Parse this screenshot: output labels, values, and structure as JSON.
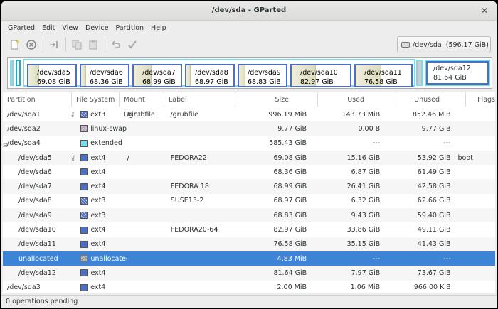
{
  "window": {
    "title": "/dev/sda - GParted"
  },
  "menu": [
    "GParted",
    "Edit",
    "View",
    "Device",
    "Partition",
    "Help"
  ],
  "toolbar": {
    "icons": [
      "new-icon",
      "delete-icon",
      "resize-move-icon",
      "copy-icon",
      "paste-icon",
      "undo-icon",
      "apply-icon"
    ]
  },
  "device": {
    "label": "/dev/sda",
    "size": "(596.17 GiB)"
  },
  "diskmap": {
    "parts": [
      {
        "name": "/dev/sda5",
        "size": "69.08 GiB",
        "used_fraction": 0.22
      },
      {
        "name": "/dev/sda6",
        "size": "68.36 GiB",
        "used_fraction": 0.1
      },
      {
        "name": "/dev/sda7",
        "size": "68.99 GiB",
        "used_fraction": 0.38
      },
      {
        "name": "/dev/sda8",
        "size": "68.97 GiB",
        "used_fraction": 0.09
      },
      {
        "name": "/dev/sda9",
        "size": "68.83 GiB",
        "used_fraction": 0.14
      },
      {
        "name": "/dev/sda10",
        "size": "82.97 GiB",
        "used_fraction": 0.41
      },
      {
        "name": "/dev/sda11",
        "size": "76.58 GiB",
        "used_fraction": 0.46
      }
    ],
    "last": {
      "name": "/dev/sda12",
      "size": "81.64 GiB"
    }
  },
  "columns": [
    "Partition",
    "File System",
    "Mount Point",
    "Label",
    "Size",
    "Used",
    "Unused",
    "Flags"
  ],
  "colors": {
    "ext3": "#4a6fc4",
    "ext4": "#4a6fc4",
    "linux-swap": "#c2a2b2",
    "extended": "#7ed8e8",
    "unallocated": "#a0a0a0",
    "selected": "#3d84d6"
  },
  "rows": [
    {
      "partition": "/dev/sda1",
      "key": true,
      "fs": "ext3",
      "mount": "/grubfile",
      "label": "/grubfile",
      "size": "996.19 MiB",
      "used": "143.73 MiB",
      "unused": "852.46 MiB",
      "flags": ""
    },
    {
      "partition": "/dev/sda2",
      "key": false,
      "fs": "linux-swap",
      "mount": "",
      "label": "",
      "size": "9.77 GiB",
      "used": "0.00 B",
      "unused": "9.77 GiB",
      "flags": ""
    },
    {
      "partition": "/dev/sda4",
      "key": false,
      "fs": "extended",
      "mount": "",
      "label": "",
      "size": "585.43 GiB",
      "used": "---",
      "unused": "---",
      "flags": "",
      "expander": "⊟"
    },
    {
      "partition": "/dev/sda5",
      "key": true,
      "fs": "ext4",
      "mount": "/",
      "label": "FEDORA22",
      "size": "69.08 GiB",
      "used": "15.16 GiB",
      "unused": "53.92 GiB",
      "flags": "boot",
      "indent": true
    },
    {
      "partition": "/dev/sda6",
      "key": false,
      "fs": "ext4",
      "mount": "",
      "label": "",
      "size": "68.36 GiB",
      "used": "6.87 GiB",
      "unused": "61.49 GiB",
      "flags": "",
      "indent": true
    },
    {
      "partition": "/dev/sda7",
      "key": false,
      "fs": "ext4",
      "mount": "",
      "label": "FEDORA 18",
      "size": "68.99 GiB",
      "used": "26.41 GiB",
      "unused": "42.58 GiB",
      "flags": "",
      "indent": true
    },
    {
      "partition": "/dev/sda8",
      "key": false,
      "fs": "ext3",
      "mount": "",
      "label": "SUSE13-2",
      "size": "68.97 GiB",
      "used": "6.32 GiB",
      "unused": "62.66 GiB",
      "flags": "",
      "indent": true
    },
    {
      "partition": "/dev/sda9",
      "key": false,
      "fs": "ext3",
      "mount": "",
      "label": "",
      "size": "68.83 GiB",
      "used": "9.43 GiB",
      "unused": "59.40 GiB",
      "flags": "",
      "indent": true
    },
    {
      "partition": "/dev/sda10",
      "key": false,
      "fs": "ext4",
      "mount": "",
      "label": "FEDORA20-64",
      "size": "82.97 GiB",
      "used": "33.86 GiB",
      "unused": "49.11 GiB",
      "flags": "",
      "indent": true
    },
    {
      "partition": "/dev/sda11",
      "key": false,
      "fs": "ext4",
      "mount": "",
      "label": "",
      "size": "76.58 GiB",
      "used": "35.15 GiB",
      "unused": "41.43 GiB",
      "flags": "",
      "indent": true
    },
    {
      "partition": "unallocated",
      "key": false,
      "fs": "unallocated",
      "mount": "",
      "label": "",
      "size": "4.83 MiB",
      "used": "---",
      "unused": "---",
      "flags": "",
      "indent": true,
      "selected": true
    },
    {
      "partition": "/dev/sda12",
      "key": false,
      "fs": "ext4",
      "mount": "",
      "label": "",
      "size": "81.64 GiB",
      "used": "7.97 GiB",
      "unused": "73.67 GiB",
      "flags": "",
      "indent": true
    },
    {
      "partition": "/dev/sda3",
      "key": false,
      "fs": "ext4",
      "mount": "",
      "label": "",
      "size": "2.00 MiB",
      "used": "1.06 MiB",
      "unused": "966.00 KiB",
      "flags": ""
    }
  ],
  "status": "0 operations pending"
}
